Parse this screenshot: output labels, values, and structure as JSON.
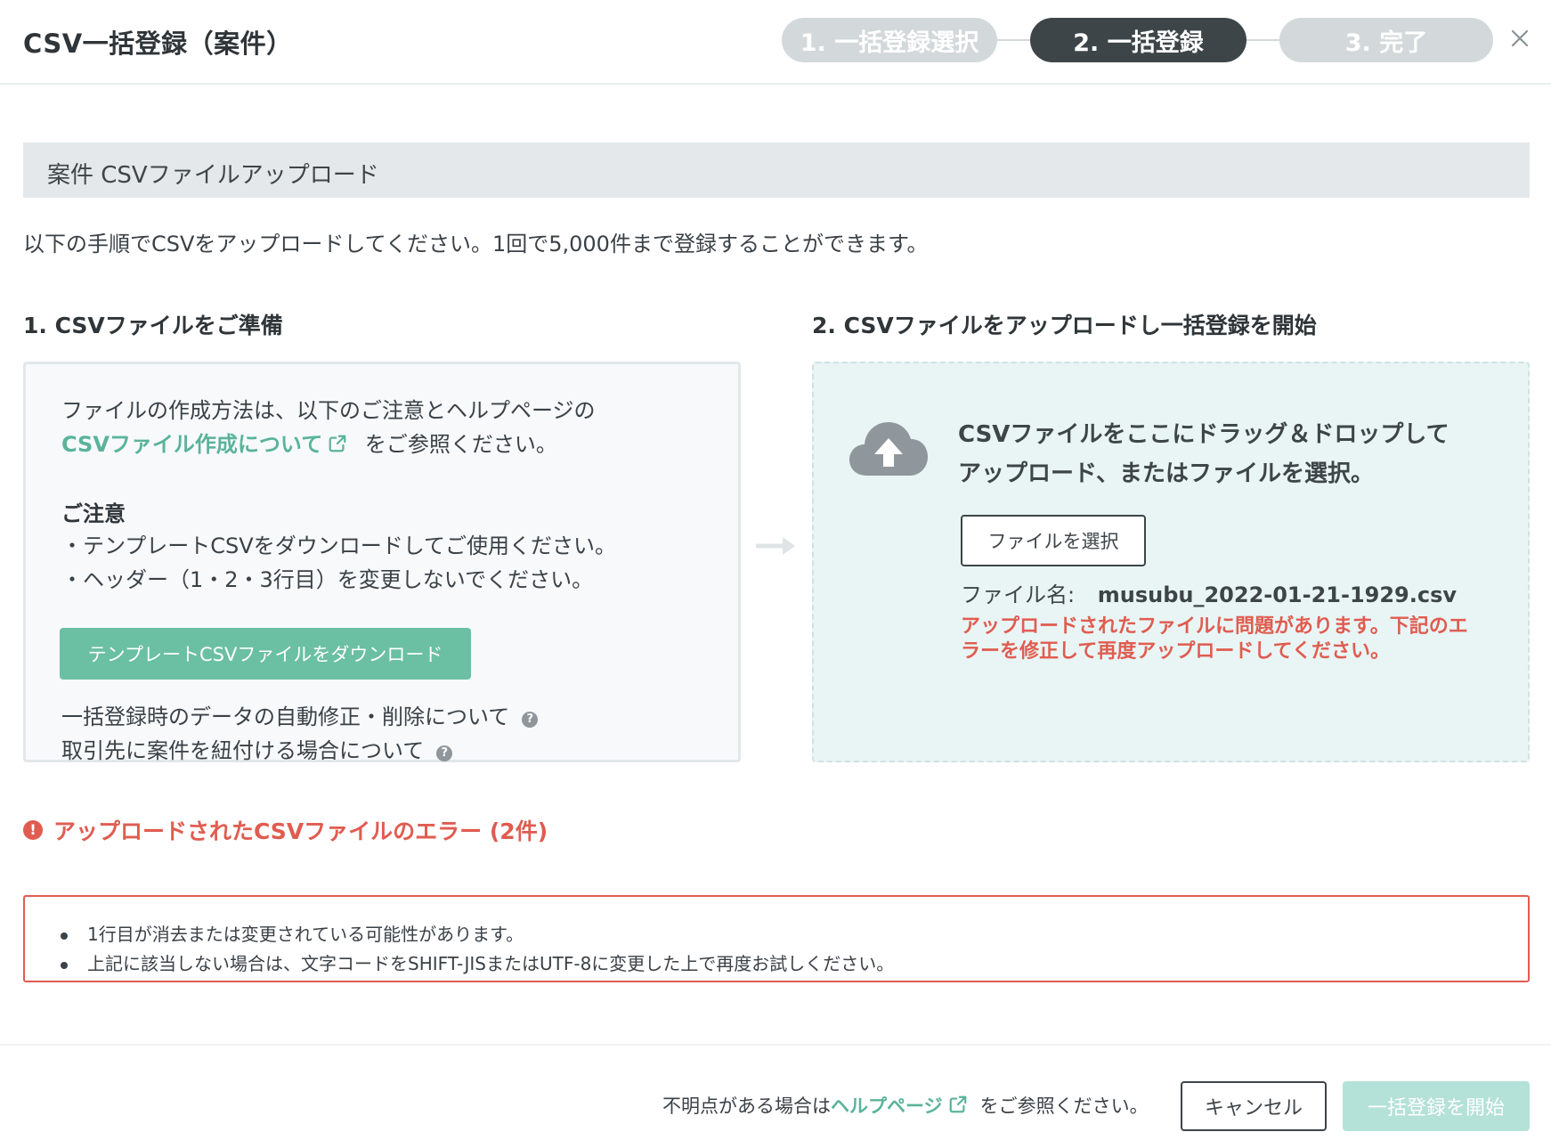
{
  "header": {
    "title": "CSV一括登録（案件）",
    "steps": [
      {
        "label": "1. 一括登録選択",
        "state": "inactive"
      },
      {
        "label": "2. 一括登録",
        "state": "active"
      },
      {
        "label": "3. 完了",
        "state": "inactive"
      }
    ],
    "close_icon": "close-icon"
  },
  "section": {
    "title": "案件 CSVファイルアップロード",
    "intro": "以下の手順でCSVをアップロードしてください。1回で5,000件まで登録することができます。"
  },
  "prepare": {
    "heading": "1. CSVファイルをご準備",
    "desc_line1": "ファイルの作成方法は、以下のご注意とヘルプページの",
    "help_link": "CSVファイル作成について",
    "desc_line2_suffix": "をご参照ください。",
    "notice_title": "ご注意",
    "notices": [
      "・テンプレートCSVをダウンロードしてご使用ください。",
      "・ヘッダー（1・2・3行目）を変更しないでください。"
    ],
    "download_button": "テンプレートCSVファイルをダウンロード",
    "info_links": [
      "一括登録時のデータの自動修正・削除について",
      "取引先に案件を紐付ける場合について"
    ]
  },
  "upload": {
    "heading": "2. CSVファイルをアップロードし一括登録を開始",
    "drop_text_line1": "CSVファイルをここにドラッグ＆ドロップして",
    "drop_text_line2": "アップロード、またはファイルを選択。",
    "select_button": "ファイルを選択",
    "file_name_label": "ファイル名:",
    "file_name_value": "musubu_2022-01-21-1929.csv",
    "error_message": "アップロードされたファイルに問題があります。下記のエラーを修正して再度アップロードしてください。"
  },
  "errors": {
    "heading": "アップロードされたCSVファイルのエラー (2件)",
    "items": [
      "1行目が消去または変更されている可能性があります。",
      "上記に該当しない場合は、文字コードをSHIFT-JISまたはUTF-8に変更した上で再度お試しください。"
    ]
  },
  "footer": {
    "note_prefix": "不明点がある場合は",
    "note_link": "ヘルプページ",
    "note_suffix": "をご参照ください。",
    "cancel_button": "キャンセル",
    "start_button": "一括登録を開始"
  },
  "colors": {
    "accent": "#6bbfa3",
    "error": "#e05c50",
    "step_active": "#3e4549",
    "step_inactive": "#d3d8da"
  }
}
